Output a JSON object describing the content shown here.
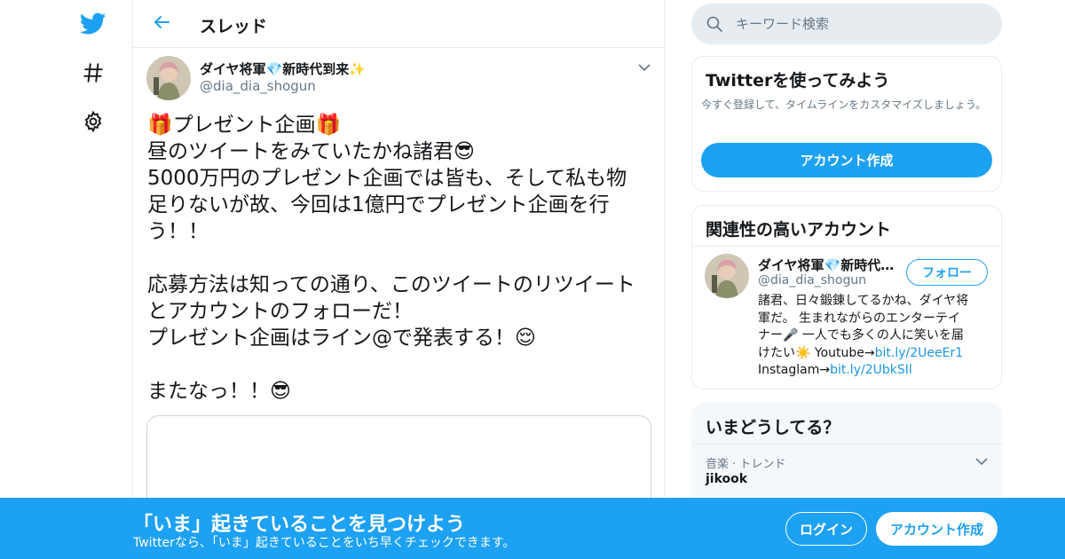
{
  "colors": {
    "brand": "#1da1f2",
    "text": "#14171a",
    "secondary": "#657786",
    "link": "#1b95e0",
    "border": "#e6ecf0"
  },
  "icons": {
    "logo": "twitter-bird-icon",
    "explore": "hashtag-icon",
    "settings": "gear-icon",
    "back": "arrow-left-icon",
    "search": "search-icon",
    "menu": "chevron-down-icon"
  },
  "header": {
    "title": "スレッド"
  },
  "search": {
    "placeholder": "キーワード検索",
    "value": ""
  },
  "tweet": {
    "display_name": "ダイヤ将軍💎新時代到来✨",
    "handle": "@dia_dia_shogun",
    "lines": [
      "🎁プレゼント企画🎁",
      "昼のツイートをみていたかね諸君😎",
      "5000万円のプレゼント企画では皆も、そして私も物",
      "足りないが故、今回は1億円でプレゼント企画を行",
      "う！！",
      "",
      "応募方法は知っての通り、このツイートのリツイート",
      "とアカウントのフォローだ！",
      "プレゼント企画はライン@で発表する！😌",
      "",
      "またなっ！！😎"
    ]
  },
  "try_card": {
    "title": "Twitterを使ってみよう",
    "description": "今すぐ登録して、タイムラインをカスタマイズしましょう。",
    "button": "アカウント作成"
  },
  "related": {
    "title": "関連性の高いアカウント",
    "account": {
      "name": "ダイヤ将軍💎新時代到来✨",
      "handle": "@dia_dia_shogun",
      "follow_label": "フォロー",
      "bio_lines": [
        "諸君、日々鍛錬してるかね、ダイヤ将",
        "軍だ。 生まれながらのエンターテイ",
        "ナー🎤 一人でも多くの人に笑いを届",
        "けたい☀️ Youtube→"
      ],
      "bio_link1": "bit.ly/2UeeEr1",
      "bio_line5": "Instaglam→",
      "bio_link2": "bit.ly/2UbkSIl"
    }
  },
  "now": {
    "title": "いまどうしてる？",
    "trend_category": "音楽 · トレンド",
    "trend_name": "jikook"
  },
  "banner": {
    "title": "「いま」起きていることを見つけよう",
    "subtitle": "Twitterなら、「いま」起きていることをいち早くチェックできます。",
    "login": "ログイン",
    "signup": "アカウント作成"
  }
}
